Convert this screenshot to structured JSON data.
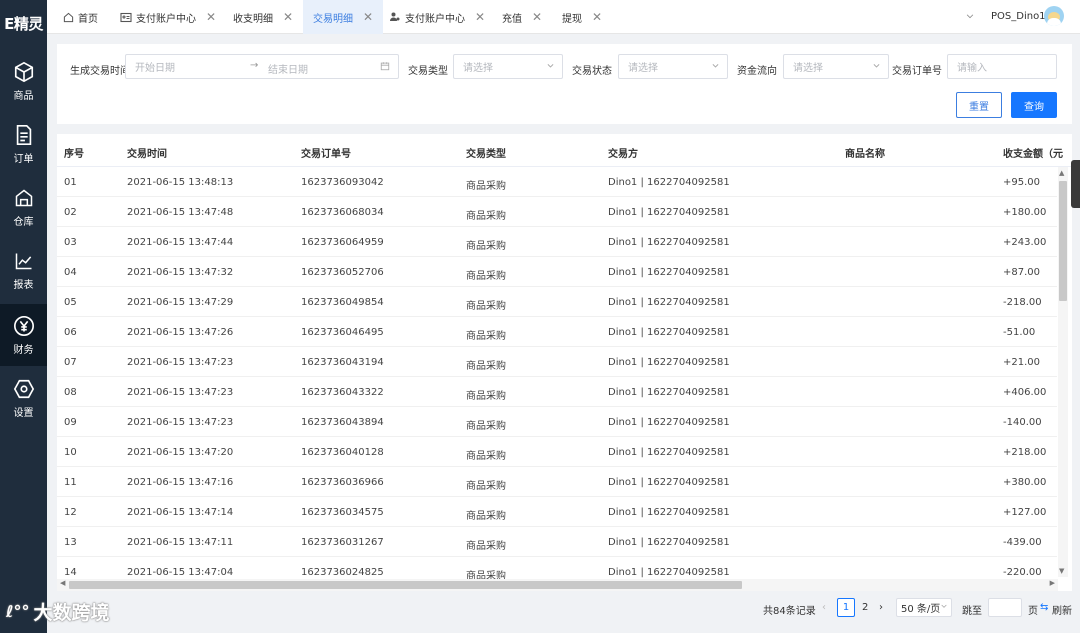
{
  "brand": "E精灵",
  "sidebar": {
    "items": [
      {
        "label": "商品",
        "icon": "cube-icon"
      },
      {
        "label": "订单",
        "icon": "document-icon"
      },
      {
        "label": "仓库",
        "icon": "warehouse-icon"
      },
      {
        "label": "报表",
        "icon": "chart-icon"
      },
      {
        "label": "财务",
        "icon": "yen-icon",
        "active": true
      },
      {
        "label": "设置",
        "icon": "hexagon-gear-icon"
      }
    ]
  },
  "tabs": [
    {
      "label": "首页",
      "icon": "home-icon",
      "closable": false
    },
    {
      "label": "支付账户中心",
      "icon": "id-card-icon",
      "closable": true
    },
    {
      "label": "收支明细",
      "closable": true
    },
    {
      "label": "交易明细",
      "closable": true,
      "active": true
    },
    {
      "label": "支付账户中心",
      "icon": "user-gear-icon",
      "closable": true
    },
    {
      "label": "充值",
      "closable": true
    },
    {
      "label": "提现",
      "closable": true
    }
  ],
  "user": {
    "name": "POS_Dino1"
  },
  "filters": {
    "gen_time_label": "生成交易时间",
    "start_placeholder": "开始日期",
    "end_placeholder": "结束日期",
    "type_label": "交易类型",
    "type_placeholder": "请选择",
    "status_label": "交易状态",
    "status_placeholder": "请选择",
    "flow_label": "资金流向",
    "flow_placeholder": "请选择",
    "order_label": "交易订单号",
    "order_placeholder": "请输入",
    "reset_label": "重置",
    "query_label": "查询"
  },
  "table": {
    "columns": [
      "序号",
      "交易时间",
      "交易订单号",
      "交易类型",
      "交易方",
      "商品名称",
      "收支金额（元"
    ],
    "rows": [
      {
        "no": "01",
        "time": "2021-06-15 13:48:13",
        "order": "1623736093042",
        "type": "商品采购",
        "party": "Dino1 | 1622704092581",
        "product": "",
        "amount": "+95.00"
      },
      {
        "no": "02",
        "time": "2021-06-15 13:47:48",
        "order": "1623736068034",
        "type": "商品采购",
        "party": "Dino1 | 1622704092581",
        "product": "",
        "amount": "+180.00"
      },
      {
        "no": "03",
        "time": "2021-06-15 13:47:44",
        "order": "1623736064959",
        "type": "商品采购",
        "party": "Dino1 | 1622704092581",
        "product": "",
        "amount": "+243.00"
      },
      {
        "no": "04",
        "time": "2021-06-15 13:47:32",
        "order": "1623736052706",
        "type": "商品采购",
        "party": "Dino1 | 1622704092581",
        "product": "",
        "amount": "+87.00"
      },
      {
        "no": "05",
        "time": "2021-06-15 13:47:29",
        "order": "1623736049854",
        "type": "商品采购",
        "party": "Dino1 | 1622704092581",
        "product": "",
        "amount": "-218.00"
      },
      {
        "no": "06",
        "time": "2021-06-15 13:47:26",
        "order": "1623736046495",
        "type": "商品采购",
        "party": "Dino1 | 1622704092581",
        "product": "",
        "amount": "-51.00"
      },
      {
        "no": "07",
        "time": "2021-06-15 13:47:23",
        "order": "1623736043194",
        "type": "商品采购",
        "party": "Dino1 | 1622704092581",
        "product": "",
        "amount": "+21.00"
      },
      {
        "no": "08",
        "time": "2021-06-15 13:47:23",
        "order": "1623736043322",
        "type": "商品采购",
        "party": "Dino1 | 1622704092581",
        "product": "",
        "amount": "+406.00"
      },
      {
        "no": "09",
        "time": "2021-06-15 13:47:23",
        "order": "1623736043894",
        "type": "商品采购",
        "party": "Dino1 | 1622704092581",
        "product": "",
        "amount": "-140.00"
      },
      {
        "no": "10",
        "time": "2021-06-15 13:47:20",
        "order": "1623736040128",
        "type": "商品采购",
        "party": "Dino1 | 1622704092581",
        "product": "",
        "amount": "+218.00"
      },
      {
        "no": "11",
        "time": "2021-06-15 13:47:16",
        "order": "1623736036966",
        "type": "商品采购",
        "party": "Dino1 | 1622704092581",
        "product": "",
        "amount": "+380.00"
      },
      {
        "no": "12",
        "time": "2021-06-15 13:47:14",
        "order": "1623736034575",
        "type": "商品采购",
        "party": "Dino1 | 1622704092581",
        "product": "",
        "amount": "+127.00"
      },
      {
        "no": "13",
        "time": "2021-06-15 13:47:11",
        "order": "1623736031267",
        "type": "商品采购",
        "party": "Dino1 | 1622704092581",
        "product": "",
        "amount": "-439.00"
      },
      {
        "no": "14",
        "time": "2021-06-15 13:47:04",
        "order": "1623736024825",
        "type": "商品采购",
        "party": "Dino1 | 1622704092581",
        "product": "",
        "amount": "-220.00"
      }
    ]
  },
  "pagination": {
    "total": "共84条记录",
    "pages": [
      "1",
      "2"
    ],
    "current": "1",
    "page_size": "50 条/页",
    "jump_label": "跳至",
    "page_suffix": "页",
    "refresh_label": "刷新"
  },
  "watermark": "大数跨境",
  "colors": {
    "sidebar": "#1f2d3d",
    "accent": "#1677ff",
    "active_tab_bg": "#e8f0fb"
  }
}
